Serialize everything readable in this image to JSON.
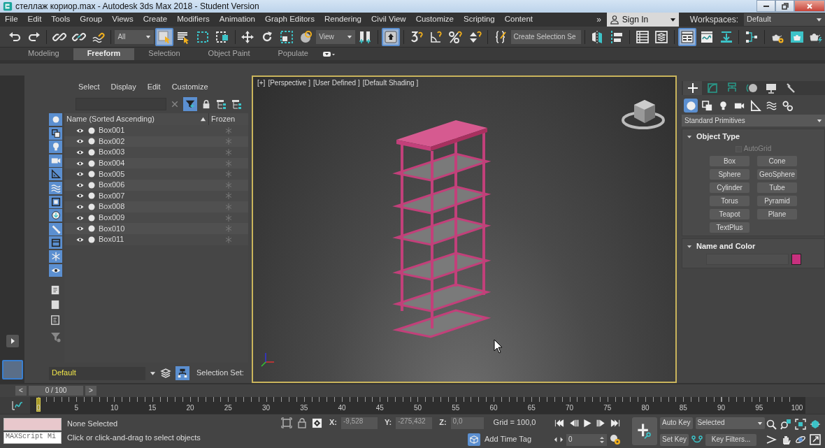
{
  "window": {
    "title": "стеллаж кориор.max - Autodesk 3ds Max 2018 - Student Version"
  },
  "menu": [
    "File",
    "Edit",
    "Tools",
    "Group",
    "Views",
    "Create",
    "Modifiers",
    "Animation",
    "Graph Editors",
    "Rendering",
    "Civil View",
    "Customize",
    "Scripting",
    "Content"
  ],
  "menu_overflow": "»",
  "account": {
    "label": "Sign In"
  },
  "workspaces": {
    "label": "Workspaces:",
    "value": "Default"
  },
  "toolbar": [
    [
      {
        "kind": "button",
        "selected": false
      },
      {
        "kind": "button",
        "selected": false
      }
    ],
    [
      {
        "kind": "button",
        "selected": false
      },
      {
        "kind": "button",
        "selected": false
      },
      {
        "kind": "button",
        "selected": false
      }
    ],
    [
      {
        "kind": "dropdown",
        "value": "All"
      },
      {
        "kind": "button",
        "selected": true
      },
      {
        "kind": "button",
        "selected": false
      },
      {
        "kind": "button",
        "selected": false
      },
      {
        "kind": "button",
        "selected": false
      }
    ],
    [
      {
        "kind": "button",
        "selected": false
      },
      {
        "kind": "button",
        "selected": false
      },
      {
        "kind": "button",
        "selected": false
      },
      {
        "kind": "button",
        "selected": false
      },
      {
        "kind": "dropdown",
        "value": "View"
      },
      {
        "kind": "button",
        "selected": false
      }
    ],
    [
      {
        "kind": "button",
        "selected": true
      }
    ],
    [
      {
        "kind": "button",
        "selected": false
      },
      {
        "kind": "button",
        "selected": false
      },
      {
        "kind": "button",
        "selected": false
      },
      {
        "kind": "button",
        "selected": false
      }
    ],
    [
      {
        "kind": "button",
        "selected": false
      },
      {
        "kind": "dropdown",
        "value": "Create Selection Se"
      }
    ],
    [
      {
        "kind": "button",
        "selected": false
      },
      {
        "kind": "button",
        "selected": false
      }
    ],
    [
      {
        "kind": "button",
        "selected": false
      },
      {
        "kind": "button",
        "selected": false
      }
    ],
    [
      {
        "kind": "button",
        "selected": true
      },
      {
        "kind": "button",
        "selected": false
      },
      {
        "kind": "button",
        "selected": false
      }
    ],
    [
      {
        "kind": "button",
        "selected": false
      }
    ],
    [
      {
        "kind": "button",
        "selected": false
      },
      {
        "kind": "button",
        "selected": false
      },
      {
        "kind": "button",
        "selected": false
      }
    ]
  ],
  "ribbon_tabs": [
    {
      "label": "Modeling",
      "selected": false
    },
    {
      "label": "Freeform",
      "selected": true
    },
    {
      "label": "Selection",
      "selected": false
    },
    {
      "label": "Object Paint",
      "selected": false
    },
    {
      "label": "Populate",
      "selected": false
    }
  ],
  "scene_explorer": {
    "menu": [
      "Select",
      "Display",
      "Edit",
      "Customize"
    ],
    "filter_toggle": {
      "on": true
    },
    "filters": [
      {
        "on": true
      },
      {
        "on": true
      },
      {
        "on": true
      },
      {
        "on": true
      },
      {
        "on": true
      },
      {
        "on": true
      },
      {
        "on": true
      },
      {
        "on": true
      },
      {
        "on": true
      },
      {
        "on": true
      },
      {
        "on": true
      },
      {
        "on": true
      }
    ],
    "columns": [
      "Name (Sorted Ascending)",
      "Frozen"
    ],
    "rows": [
      {
        "name": "Box001"
      },
      {
        "name": "Box002"
      },
      {
        "name": "Box003"
      },
      {
        "name": "Box004"
      },
      {
        "name": "Box005"
      },
      {
        "name": "Box006"
      },
      {
        "name": "Box007"
      },
      {
        "name": "Box008"
      },
      {
        "name": "Box009"
      },
      {
        "name": "Box010"
      },
      {
        "name": "Box011"
      }
    ],
    "layer": "Default",
    "selection_set_label": "Selection Set:"
  },
  "viewport": {
    "labels": [
      "[+]",
      "[Perspective ]",
      "[User Defined ]",
      "[Default Shading ]"
    ]
  },
  "command_panel": {
    "tabs": [
      {
        "selected": true
      },
      {
        "selected": false
      },
      {
        "selected": false
      },
      {
        "selected": false
      },
      {
        "selected": false
      },
      {
        "selected": false
      }
    ],
    "categories": [
      {
        "selected": true
      },
      {
        "selected": false
      },
      {
        "selected": false
      },
      {
        "selected": false
      },
      {
        "selected": false
      },
      {
        "selected": false
      },
      {
        "selected": false
      }
    ],
    "category_dropdown": "Standard Primitives",
    "object_type": {
      "title": "Object Type",
      "autogrid": {
        "label": "AutoGrid",
        "checked": false,
        "disabled": true
      },
      "buttons": [
        "Box",
        "Cone",
        "Sphere",
        "GeoSphere",
        "Cylinder",
        "Tube",
        "Torus",
        "Pyramid",
        "Teapot",
        "Plane",
        "TextPlus"
      ]
    },
    "name_and_color": {
      "title": "Name and Color",
      "color": "#c8307e"
    }
  },
  "time_slider": {
    "prev": "<",
    "frame": "0 / 100",
    "next": ">",
    "level": 0
  },
  "track_bar": {
    "ticks": [
      "0",
      "5",
      "10",
      "15",
      "20",
      "25",
      "30",
      "35",
      "40",
      "45",
      "50",
      "55",
      "60",
      "65",
      "70",
      "75",
      "80",
      "85",
      "90",
      "95",
      "100"
    ]
  },
  "status": {
    "listener": "MAXScript Mi",
    "selection": "None Selected",
    "prompt": "Click or click-and-drag to select objects",
    "coords": [
      {
        "axis": "X:",
        "value": "-9,528"
      },
      {
        "axis": "Y:",
        "value": "-275,432"
      },
      {
        "axis": "Z:",
        "value": "0,0"
      }
    ],
    "grid": "Grid = 100,0",
    "time_tag": "Add Time Tag",
    "frame": "0",
    "auto_key": "Auto Key",
    "set_key": "Set Key",
    "key_set": "Selected",
    "key_filters": "Key Filters..."
  }
}
